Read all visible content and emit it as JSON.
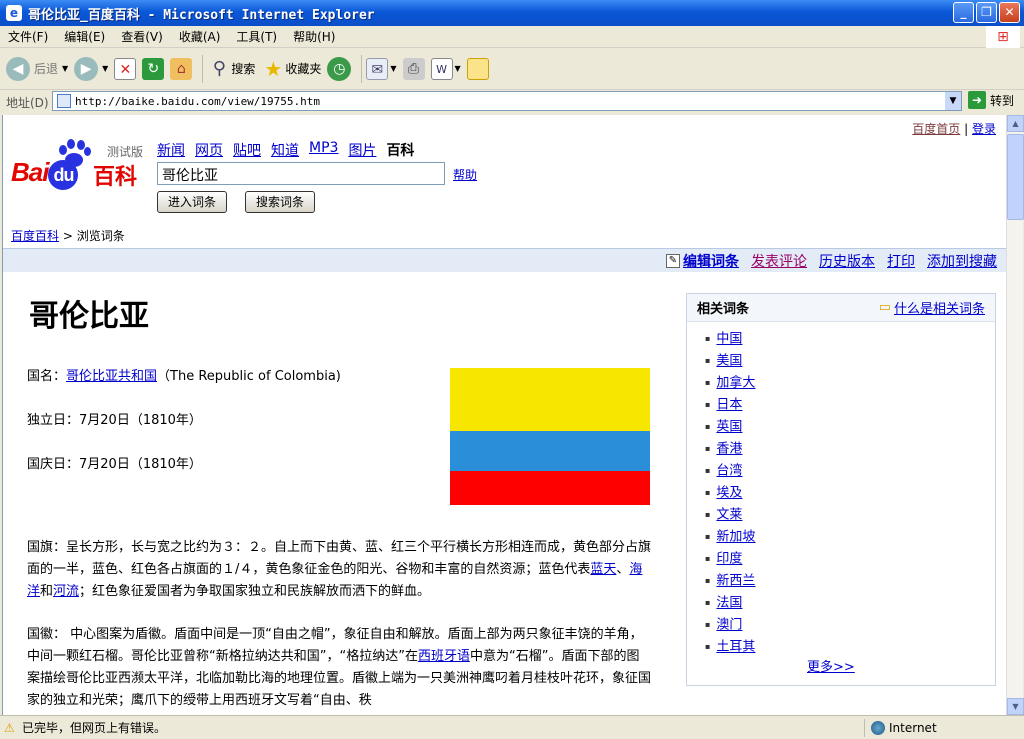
{
  "window": {
    "title": "哥伦比亚_百度百科 - Microsoft Internet Explorer"
  },
  "menu": [
    "文件(F)",
    "编辑(E)",
    "查看(V)",
    "收藏(A)",
    "工具(T)",
    "帮助(H)"
  ],
  "toolbar": {
    "back": "后退",
    "search": "搜索",
    "favorites": "收藏夹"
  },
  "address": {
    "label": "地址(D)",
    "url": "http://baike.baidu.com/view/19755.htm",
    "go": "转到"
  },
  "page": {
    "top_links": {
      "home": "百度首页",
      "login": "登录"
    },
    "logo": {
      "brand": "Bai",
      "du": "du",
      "baike": "百科",
      "beta": "测试版"
    },
    "nav": [
      "新闻",
      "网页",
      "贴吧",
      "知道",
      "MP3",
      "图片",
      "百科"
    ],
    "search_value": "哥伦比亚",
    "help": "帮助",
    "btn_enter": "进入词条",
    "btn_search": "搜索词条",
    "breadcrumb": {
      "root": "百度百科",
      "current": "> 浏览词条"
    },
    "edit_bar": {
      "edit": "编辑词条",
      "comment": "发表评论",
      "history": "历史版本",
      "print": "打印",
      "favorite": "添加到搜藏"
    },
    "title": "哥伦比亚",
    "info": {
      "name_prefix": "国名：",
      "name_link": "哥伦比亚共和国",
      "name_suffix": "（The Republic of Colombia)",
      "independence": "独立日：7月20日（1810年）",
      "national_day": "国庆日：7月20日（1810年）"
    },
    "flag_colors": [
      "#f7e600",
      "#2a8fd8",
      "#ff0000"
    ],
    "para_flag": {
      "a": "国旗：呈长方形，长与宽之比约为３：２。自上而下由黄、蓝、红三个平行横长方形相连而成，黄色部分占旗面的一半，蓝色、红色各占旗面的１/４，黄色象征金色的阳光、谷物和丰富的自然资源；蓝色代表",
      "l1": "蓝天",
      "s1": "、",
      "l2": "海洋",
      "s2": "和",
      "l3": "河流",
      "b": "；红色象征爱国者为争取国家独立和民族解放而洒下的鲜血。"
    },
    "para_emblem": {
      "a": "国徽： 中心图案为盾徽。盾面中间是一顶“自由之帽”，象征自由和解放。盾面上部为两只象征丰饶的羊角，中间一颗红石榴。哥伦比亚曾称“新格拉纳达共和国”，“格拉纳达”在",
      "link": "西班牙语",
      "b": "中意为“石榴”。盾面下部的图案描绘哥伦比亚西濒太平洋，北临加勒比海的地理位置。盾徽上端为一只美洲神鹰叼着月桂枝叶花环，象征国家的独立和光荣；鹰爪下的绶带上用西班牙文写着“自由、秩"
    },
    "related": {
      "title": "相关词条",
      "what": "什么是相关词条",
      "items": [
        "中国",
        "美国",
        "加拿大",
        "日本",
        "英国",
        "香港",
        "台湾",
        "埃及",
        "文莱",
        "新加坡",
        "印度",
        "新西兰",
        "法国",
        "澳门",
        "土耳其"
      ],
      "more": "更多>>"
    }
  },
  "status": {
    "text": "已完毕，但网页上有错误。",
    "zone": "Internet"
  }
}
